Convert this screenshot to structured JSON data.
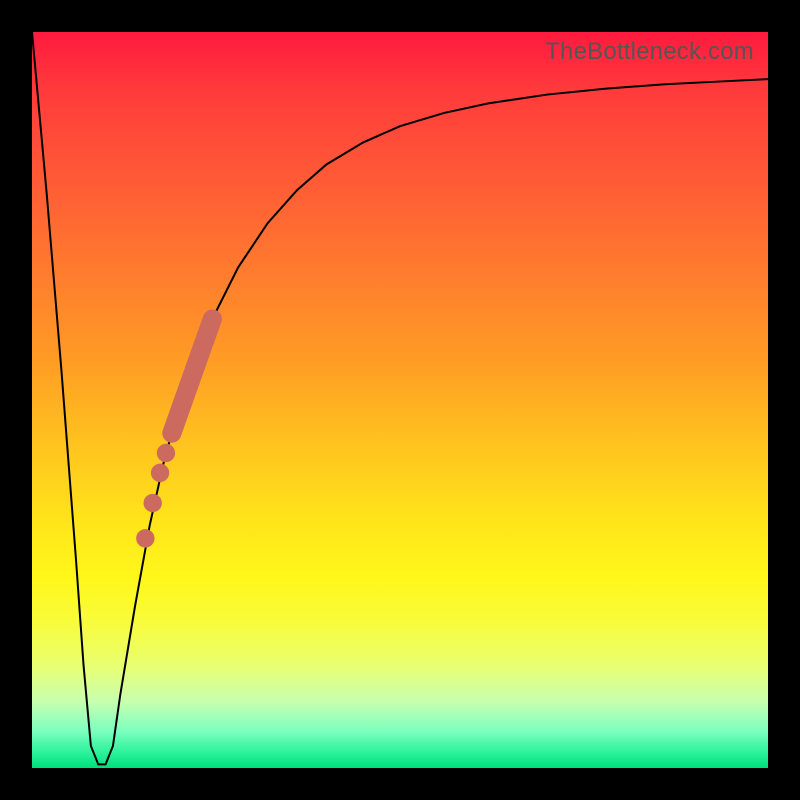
{
  "watermark": "TheBottleneck.com",
  "colors": {
    "curve": "#000000",
    "marker": "#cc6a60",
    "frame": "#000000"
  },
  "chart_data": {
    "type": "line",
    "title": "",
    "xlabel": "",
    "ylabel": "",
    "xlim": [
      0,
      100
    ],
    "ylim": [
      0,
      100
    ],
    "grid": false,
    "legend": false,
    "series": [
      {
        "name": "bottleneck-curve",
        "x": [
          0,
          2,
          4,
          6,
          7,
          8,
          9,
          10,
          11,
          12,
          14,
          16,
          18,
          20,
          22,
          25,
          28,
          32,
          36,
          40,
          45,
          50,
          56,
          62,
          70,
          78,
          86,
          94,
          100
        ],
        "y": [
          100,
          78,
          54,
          28,
          14,
          3,
          0.5,
          0.5,
          3,
          10,
          22,
          33,
          42,
          49,
          55,
          62,
          68,
          74,
          78.5,
          82,
          85,
          87.2,
          89,
          90.3,
          91.5,
          92.3,
          92.9,
          93.3,
          93.6
        ]
      }
    ],
    "markers": [
      {
        "shape": "segment",
        "x0": 19.0,
        "y0": 45.5,
        "x1": 24.5,
        "y1": 61.0,
        "width": 2.6
      },
      {
        "shape": "dot",
        "cx": 18.2,
        "cy": 42.8,
        "r": 1.25
      },
      {
        "shape": "dot",
        "cx": 17.4,
        "cy": 40.1,
        "r": 1.25
      },
      {
        "shape": "dot",
        "cx": 16.4,
        "cy": 36.0,
        "r": 1.25
      },
      {
        "shape": "dot",
        "cx": 15.4,
        "cy": 31.2,
        "r": 1.25
      }
    ]
  }
}
